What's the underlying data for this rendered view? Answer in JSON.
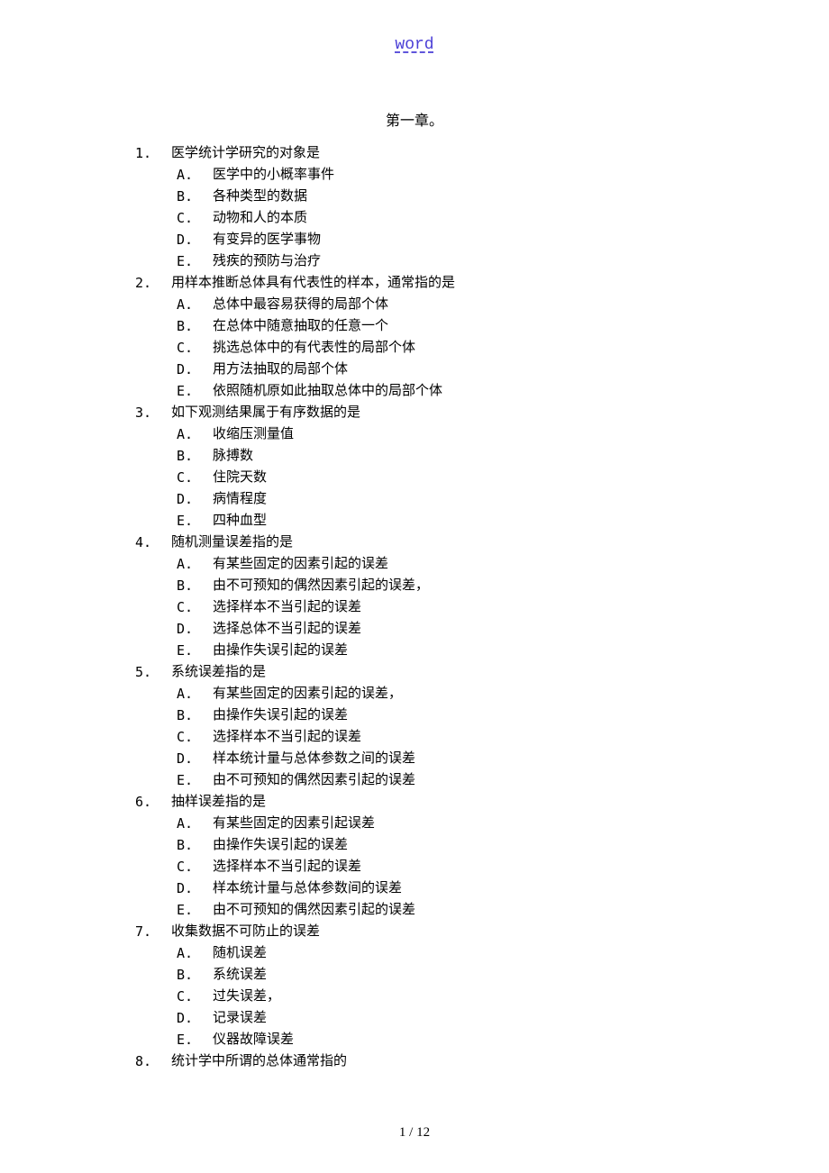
{
  "header": {
    "link_text": "word"
  },
  "chapter": {
    "title": "第一章。"
  },
  "questions": [
    {
      "num": "1.",
      "text": "医学统计学研究的对象是",
      "options": [
        {
          "letter": "A.",
          "text": "医学中的小概率事件"
        },
        {
          "letter": "B.",
          "text": "各种类型的数据"
        },
        {
          "letter": "C.",
          "text": "动物和人的本质"
        },
        {
          "letter": "D.",
          "text": "有变异的医学事物"
        },
        {
          "letter": "E.",
          "text": "残疾的预防与治疗"
        }
      ]
    },
    {
      "num": "2.",
      "text": "用样本推断总体具有代表性的样本，通常指的是",
      "options": [
        {
          "letter": "A.",
          "text": "总体中最容易获得的局部个体"
        },
        {
          "letter": "B.",
          "text": "在总体中随意抽取的任意一个"
        },
        {
          "letter": "C.",
          "text": "挑选总体中的有代表性的局部个体"
        },
        {
          "letter": "D.",
          "text": "用方法抽取的局部个体"
        },
        {
          "letter": "E.",
          "text": "依照随机原如此抽取总体中的局部个体"
        }
      ]
    },
    {
      "num": "3.",
      "text": "如下观测结果属于有序数据的是",
      "options": [
        {
          "letter": "A.",
          "text": "收缩压测量值"
        },
        {
          "letter": "B.",
          "text": "脉搏数"
        },
        {
          "letter": "C.",
          "text": "住院天数"
        },
        {
          "letter": "D.",
          "text": "病情程度"
        },
        {
          "letter": "E.",
          "text": "四种血型"
        }
      ]
    },
    {
      "num": "4.",
      "text": "随机测量误差指的是",
      "options": [
        {
          "letter": "A.",
          "text": "有某些固定的因素引起的误差"
        },
        {
          "letter": "B.",
          "text": "由不可预知的偶然因素引起的误差，"
        },
        {
          "letter": "C.",
          "text": "选择样本不当引起的误差"
        },
        {
          "letter": "D.",
          "text": "选择总体不当引起的误差"
        },
        {
          "letter": "E.",
          "text": "由操作失误引起的误差"
        }
      ]
    },
    {
      "num": "5.",
      "text": "系统误差指的是",
      "options": [
        {
          "letter": "A.",
          "text": "有某些固定的因素引起的误差，"
        },
        {
          "letter": "B.",
          "text": "由操作失误引起的误差"
        },
        {
          "letter": "C.",
          "text": "选择样本不当引起的误差"
        },
        {
          "letter": "D.",
          "text": "样本统计量与总体参数之间的误差"
        },
        {
          "letter": "E.",
          "text": "由不可预知的偶然因素引起的误差"
        }
      ]
    },
    {
      "num": "6.",
      "text": "抽样误差指的是",
      "options": [
        {
          "letter": "A.",
          "text": "有某些固定的因素引起误差"
        },
        {
          "letter": "B.",
          "text": "由操作失误引起的误差"
        },
        {
          "letter": "C.",
          "text": "选择样本不当引起的误差"
        },
        {
          "letter": "D.",
          "text": "样本统计量与总体参数间的误差"
        },
        {
          "letter": "E.",
          "text": "由不可预知的偶然因素引起的误差"
        }
      ]
    },
    {
      "num": "7.",
      "text": "收集数据不可防止的误差",
      "options": [
        {
          "letter": "A.",
          "text": "随机误差"
        },
        {
          "letter": "B.",
          "text": "系统误差"
        },
        {
          "letter": "C.",
          "text": "过失误差，"
        },
        {
          "letter": "D.",
          "text": "记录误差"
        },
        {
          "letter": "E.",
          "text": "仪器故障误差"
        }
      ]
    },
    {
      "num": "8.",
      "text": "统计学中所谓的总体通常指的",
      "options": []
    }
  ],
  "footer": {
    "page_indicator": "1 / 12"
  }
}
